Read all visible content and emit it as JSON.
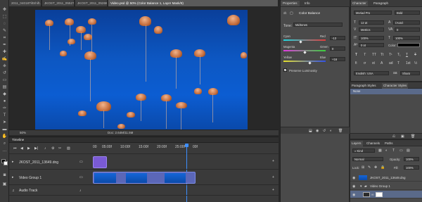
{
  "doc_tabs": [
    {
      "label": "2011_04018TiltShift.psd"
    },
    {
      "label": "JKOST_2011_05527iris.psd"
    },
    {
      "label": "JKOST_2011_05268.psd"
    },
    {
      "label": "Video.psd @ 50% (Color Balance 1, Layer Mask/8)"
    }
  ],
  "status": {
    "zoom": "50%",
    "doc": "Doc: 2.64M/11.5M"
  },
  "timeline": {
    "title": "Timeline",
    "timecodes": [
      "00",
      "05:00f",
      "10:00f",
      "15:00f",
      "20:00f",
      "25:00f",
      "00f"
    ],
    "tracks": [
      {
        "label": "JKOST_2011_13649.dng"
      },
      {
        "label": "Video Group 1"
      },
      {
        "label": "Audio Track"
      }
    ]
  },
  "properties": {
    "tabs": [
      "Properties",
      "Info"
    ],
    "header": "Color Balance",
    "tone_label": "Tone:",
    "tone_value": "Midtones",
    "sliders": [
      {
        "left": "Cyan",
        "right": "Red",
        "value": "-13",
        "fraction": 0.4
      },
      {
        "left": "Magenta",
        "right": "Green",
        "value": "0",
        "fraction": 0.5
      },
      {
        "left": "Yellow",
        "right": "Blue",
        "value": "+16",
        "fraction": 0.62
      }
    ],
    "preserve": "Preserve Luminosity"
  },
  "character": {
    "tabs": [
      "Character",
      "Paragraph"
    ],
    "font": "Myriad Pro",
    "style": "Bold",
    "size": "12 pt",
    "leading": "(Auto)",
    "kerning": "Metrics",
    "tracking": "0",
    "vscale": "100%",
    "hscale": "100%",
    "baseline": "0 pt",
    "color_label": "Color:",
    "style_buttons": [
      "T",
      "T",
      "TT",
      "Tt",
      "T¹",
      "T₁",
      "T",
      "T"
    ],
    "ot_buttons": [
      "fi",
      "ơ",
      "st",
      "A",
      "ad",
      "T",
      "1st",
      "½"
    ],
    "language": "English: USA",
    "aa": "Sharp"
  },
  "styles": {
    "tabs": [
      "Paragraph Styles",
      "Character Styles"
    ],
    "item": "None"
  },
  "layers": {
    "tabs": [
      "Layers",
      "Channels",
      "Paths"
    ],
    "kind": "Kind",
    "blend": "Normal",
    "opacity_label": "Opacity:",
    "opacity": "100%",
    "lock": "Lock:",
    "fill_label": "Fill:",
    "fill": "100%",
    "rows": [
      {
        "label": "JKOST_2011_13649.dng"
      },
      {
        "label": "Video Group 1"
      },
      {
        "label": ""
      }
    ]
  },
  "colors": {
    "accent": "#3a6fd8",
    "clip": "#7a5ad4",
    "playhead": "#3d8fff",
    "image_blue": "#0c5dd2"
  }
}
